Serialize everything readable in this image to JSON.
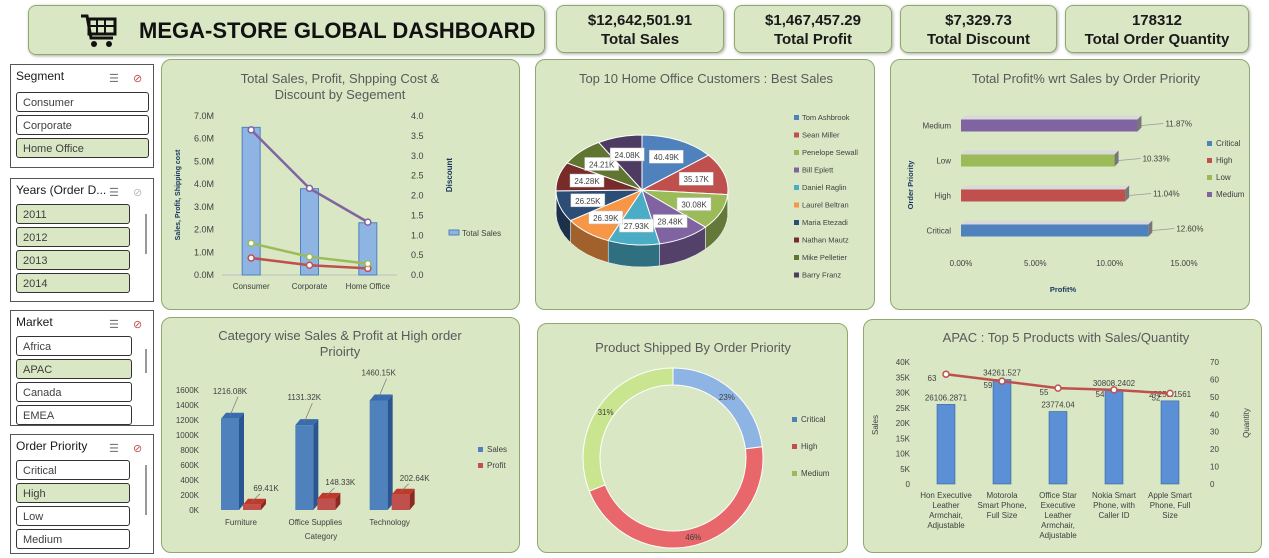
{
  "header": {
    "title": "MEGA-STORE GLOBAL DASHBOARD",
    "logo_icon": "shopping-cart-icon"
  },
  "kpis": [
    {
      "value": "$12,642,501.91",
      "label": "Total Sales"
    },
    {
      "value": "$1,467,457.29",
      "label": "Total Profit"
    },
    {
      "value": "$7,329.73",
      "label": "Total Discount"
    },
    {
      "value": "178312",
      "label": "Total Order Quantity"
    }
  ],
  "slicers": [
    {
      "title": "Segment",
      "items": [
        {
          "label": "Consumer",
          "selected": false
        },
        {
          "label": "Corporate",
          "selected": false
        },
        {
          "label": "Home Office",
          "selected": true
        }
      ]
    },
    {
      "title": "Years (Order D...",
      "items": [
        {
          "label": "2011",
          "selected": true
        },
        {
          "label": "2012",
          "selected": true
        },
        {
          "label": "2013",
          "selected": true
        },
        {
          "label": "2014",
          "selected": true
        }
      ]
    },
    {
      "title": "Market",
      "items": [
        {
          "label": "Africa",
          "selected": false
        },
        {
          "label": "APAC",
          "selected": true
        },
        {
          "label": "Canada",
          "selected": false
        },
        {
          "label": "EMEA",
          "selected": false
        }
      ]
    },
    {
      "title": "Order Priority",
      "items": [
        {
          "label": "Critical",
          "selected": false
        },
        {
          "label": "High",
          "selected": true
        },
        {
          "label": "Low",
          "selected": false
        },
        {
          "label": "Medium",
          "selected": false
        }
      ]
    }
  ],
  "colors": {
    "panel": "#d9e7c4",
    "blue": "#4f81bd",
    "red": "#c0504d",
    "green": "#9bbb59",
    "purple": "#8064a2"
  },
  "chart_data": [
    {
      "id": "segment",
      "type": "bar",
      "title": "Total Sales, Profit, Shpping Cost & Discount by Segement",
      "categories": [
        "Consumer",
        "Corporate",
        "Home Office"
      ],
      "series": [
        {
          "name": "Total Sales",
          "values": [
            6.5,
            3.8,
            2.3
          ],
          "axis": "left"
        },
        {
          "values": [
            0.75,
            0.43,
            0.29
          ],
          "axis": "left"
        },
        {
          "values": [
            1.4,
            0.8,
            0.5
          ],
          "axis": "left"
        },
        {
          "values": [
            3.65,
            2.18,
            1.33
          ],
          "axis": "right"
        }
      ],
      "ylabel": "Sales, Profit, Shipping cost",
      "y2label": "Discount",
      "ylim": [
        0,
        7.0
      ],
      "y2lim": [
        0,
        4.0
      ],
      "yticks": [
        "0.0M",
        "1.0M",
        "2.0M",
        "3.0M",
        "4.0M",
        "5.0M",
        "6.0M",
        "7.0M"
      ],
      "y2ticks": [
        "0.0",
        "0.5",
        "1.0",
        "1.5",
        "2.0",
        "2.5",
        "3.0",
        "3.5",
        "4.0"
      ],
      "legend": "right"
    },
    {
      "id": "customers",
      "type": "pie",
      "title": "Top 10 Home Office Customers : Best Sales",
      "labels": [
        "Tom Ashbrook",
        "Sean Miller",
        "Penelope Sewall",
        "Bill Eplett",
        "Daniel Raglin",
        "Laurel Beltran",
        "Maria Etezadi",
        "Nathan Mautz",
        "Mike Pelletier",
        "Barry Franz"
      ],
      "values": [
        40.49,
        35.17,
        30.08,
        28.48,
        27.93,
        26.39,
        26.25,
        24.28,
        24.21,
        24.08
      ],
      "data_labels": [
        "40.49K",
        "35.17K",
        "30.08K",
        "28.48K",
        "27.93K",
        "26.39K",
        "26.25K",
        "24.28K",
        "24.21K",
        "24.08K"
      ],
      "legend": "right"
    },
    {
      "id": "profit_pct",
      "type": "bar",
      "orientation": "horizontal",
      "title": "Total Profit% wrt Sales by Order Priority",
      "categories": [
        "Critical",
        "High",
        "Low",
        "Medium"
      ],
      "values": [
        12.6,
        11.04,
        10.33,
        11.87
      ],
      "data_labels": [
        "12.60%",
        "11.04%",
        "10.33%",
        "11.87%"
      ],
      "xlabel": "Profit%",
      "ylabel": "Order Priority",
      "xlim": [
        0,
        15
      ],
      "xticks": [
        "0.00%",
        "5.00%",
        "10.00%",
        "15.00%"
      ],
      "legend_items": [
        "Critical",
        "High",
        "Low",
        "Medium"
      ],
      "legend": "right"
    },
    {
      "id": "category",
      "type": "bar",
      "title": "Category wise Sales & Profit at High order Prioirty",
      "categories": [
        "Furniture",
        "Office Supplies",
        "Technology"
      ],
      "series": [
        {
          "name": "Sales",
          "values": [
            1216.08,
            1131.32,
            1460.15
          ],
          "data_labels": [
            "1216.08K",
            "1131.32K",
            "1460.15K"
          ]
        },
        {
          "name": "Profit",
          "values": [
            69.41,
            148.33,
            202.64
          ],
          "data_labels": [
            "69.41K",
            "148.33K",
            "202.64K"
          ]
        }
      ],
      "xlabel": "Category",
      "ylim": [
        0,
        1600
      ],
      "yticks": [
        "0K",
        "200K",
        "400K",
        "600K",
        "800K",
        "1000K",
        "1200K",
        "1400K",
        "1600K"
      ],
      "legend": "right"
    },
    {
      "id": "shipped",
      "type": "pie",
      "subtype": "doughnut",
      "title": "Product Shipped By Order Priority",
      "labels": [
        "Critical",
        "High",
        "Medium"
      ],
      "values": [
        23,
        46,
        31
      ],
      "data_labels": [
        "23%",
        "46%",
        "31%"
      ],
      "legend": "right"
    },
    {
      "id": "apac",
      "type": "bar",
      "title": "APAC : Top 5 Products with Sales/Quantity",
      "categories": [
        "Hon Executive Leather Armchair, Adjustable",
        "Motorola Smart Phone, Full Size",
        "Office Star Executive Leather Armchair, Adjustable",
        "Nokia Smart Phone, with Caller ID",
        "Apple Smart Phone, Full Size"
      ],
      "category_lines": [
        [
          "Hon Executive",
          "Leather",
          "Armchair,",
          "Adjustable"
        ],
        [
          "Motorola",
          "Smart Phone,",
          "Full Size"
        ],
        [
          "Office Star",
          "Executive",
          "Leather",
          "Armchair,",
          "Adjustable"
        ],
        [
          "Nokia Smart",
          "Phone, with",
          "Caller ID"
        ],
        [
          "Apple Smart",
          "Phone, Full",
          "Size"
        ]
      ],
      "series": [
        {
          "name": "Sales",
          "values": [
            26106.2871,
            34261.527,
            23774.04,
            30808.2402,
            27251.1561
          ],
          "data_labels": [
            "26106.2871",
            "34261.527",
            "23774.04",
            "30808.2402",
            "27251.1561"
          ]
        },
        {
          "name": "Quantity",
          "values": [
            63,
            59,
            55,
            54,
            52
          ],
          "data_labels": [
            "63",
            "59",
            "55",
            "54",
            "52"
          ]
        }
      ],
      "ylabel": "Sales",
      "y2label": "Quantity",
      "ylim": [
        0,
        40000
      ],
      "y2lim": [
        0,
        70
      ],
      "yticks": [
        "0",
        "5K",
        "10K",
        "15K",
        "20K",
        "25K",
        "30K",
        "35K",
        "40K"
      ],
      "y2ticks": [
        "0",
        "10",
        "20",
        "30",
        "40",
        "50",
        "60",
        "70"
      ]
    }
  ]
}
